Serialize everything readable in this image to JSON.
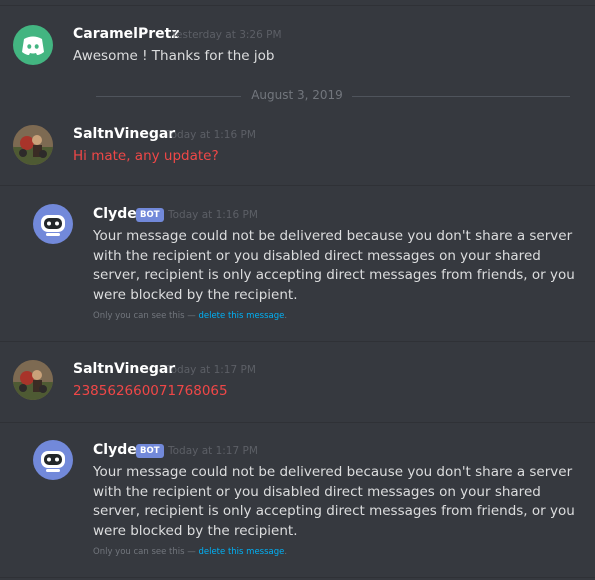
{
  "colors": {
    "background": "#36393f",
    "accent": "#7289da",
    "link": "#00b0f4",
    "error_text": "#f04747"
  },
  "date_divider": "August 3, 2019",
  "messages": [
    {
      "author": "CaramelPretz",
      "timestamp": "Yesterday at 3:26 PM",
      "text": "Awesome ! Thanks for the job",
      "avatar": "discord-logo-icon"
    },
    {
      "author": "SaltnVinegar",
      "timestamp": "Today at 1:16 PM",
      "text": "Hi mate, any update?",
      "avatar": "user-photo-avatar"
    },
    {
      "author": "Clyde",
      "bot_tag": "BOT",
      "timestamp": "Today at 1:16 PM",
      "text": "Your message could not be delivered because you don't share a server with the recipient or you disabled direct messages on your shared server, recipient is only accepting direct messages from friends, or you were blocked by the recipient.",
      "ephemeral_note": "Only you can see this —",
      "ephemeral_link": "delete this message",
      "ephemeral_end": ".",
      "avatar": "clyde-bot-icon"
    },
    {
      "author": "SaltnVinegar",
      "timestamp": "Today at 1:17 PM",
      "text": "238562660071768065",
      "avatar": "user-photo-avatar"
    },
    {
      "author": "Clyde",
      "bot_tag": "BOT",
      "timestamp": "Today at 1:17 PM",
      "text": "Your message could not be delivered because you don't share a server with the recipient or you disabled direct messages on your shared server, recipient is only accepting direct messages from friends, or you were blocked by the recipient.",
      "ephemeral_note": "Only you can see this —",
      "ephemeral_link": "delete this message",
      "ephemeral_end": ".",
      "avatar": "clyde-bot-icon"
    }
  ]
}
